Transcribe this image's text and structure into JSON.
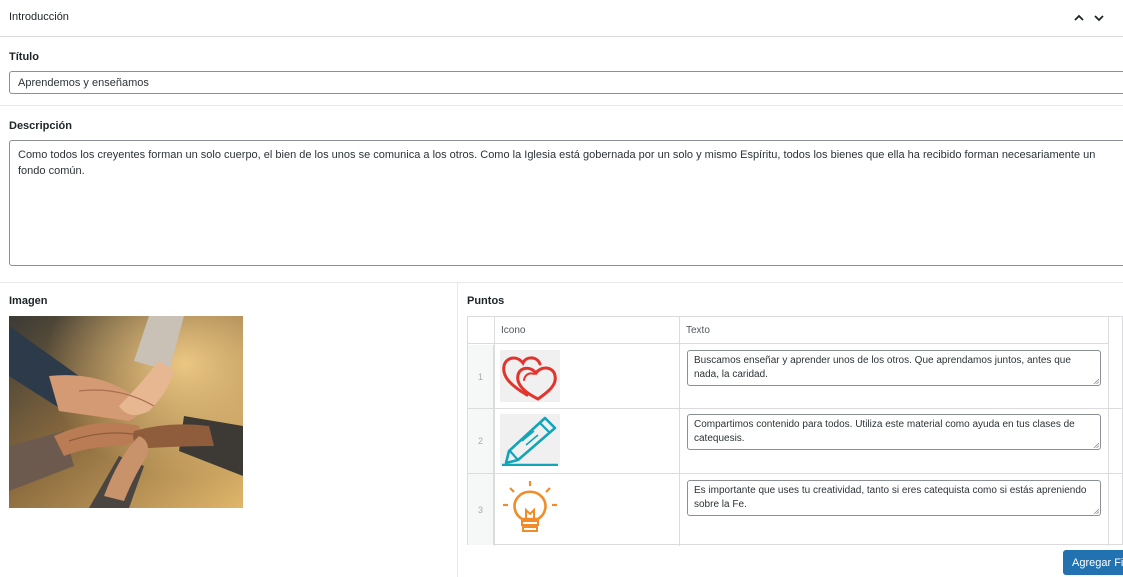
{
  "panel": {
    "title": "Introducción",
    "move_up_icon": "chevron-up-icon",
    "move_down_icon": "chevron-down-icon"
  },
  "titulo": {
    "label": "Título",
    "value": "Aprendemos y enseñamos"
  },
  "descripcion": {
    "label": "Descripción",
    "value": "Como todos los creyentes forman un solo cuerpo, el bien de los unos se comunica a los otros. Como la Iglesia está gobernada por un solo y mismo Espíritu, todos los bienes que ella ha recibido forman necesariamente un fondo común."
  },
  "imagen": {
    "label": "Imagen"
  },
  "puntos": {
    "label": "Puntos",
    "columns": [
      "Icono",
      "Texto"
    ],
    "rows": [
      {
        "num": "1",
        "icon": "hearts-icon",
        "icon_color": "#e2342c",
        "text": "Buscamos enseñar y aprender unos de los otros. Que aprendamos juntos, antes que nada, la caridad."
      },
      {
        "num": "2",
        "icon": "pencil-icon",
        "icon_color": "#12a4b8",
        "text": "Compartimos contenido para todos. Utiliza este material como ayuda en tus clases de catequesis."
      },
      {
        "num": "3",
        "icon": "lightbulb-icon",
        "icon_color": "#f28c28",
        "text": "Es importante que uses tu creatividad, tanto si eres catequista como si estás apreniendo sobre la Fe."
      }
    ],
    "add_button": "Agregar Fila"
  },
  "colors": {
    "accent": "#2271b1",
    "border": "#dcdcde"
  }
}
